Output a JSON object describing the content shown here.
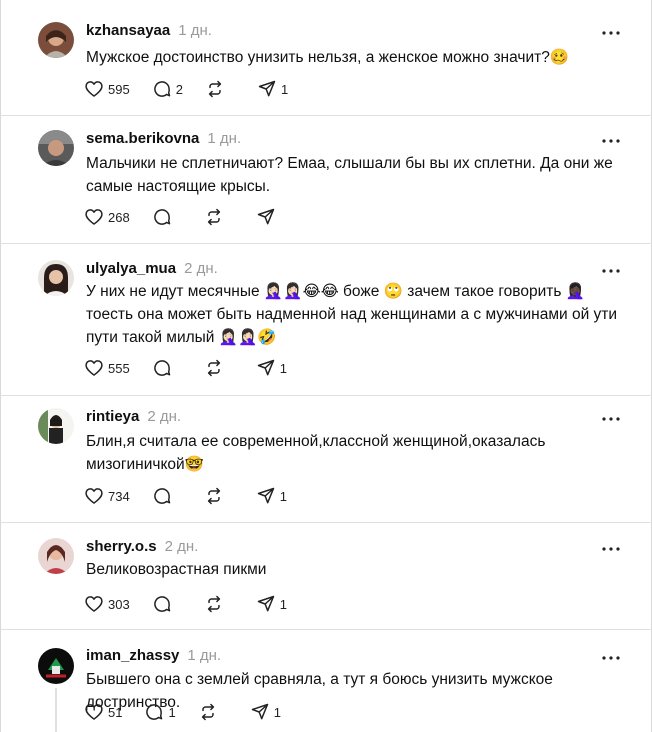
{
  "icons": {
    "like": "heart-icon",
    "reply": "comment-icon",
    "repost": "repost-icon",
    "share": "send-icon",
    "more": "more-dots-icon"
  },
  "colors": {
    "text": "#101010",
    "muted": "#9a9a9a",
    "divider": "#e0e0e0"
  },
  "posts": [
    {
      "username": "kzhansayaa",
      "time": "1 дн.",
      "text": "Мужское достоинство унизить нельзя, а женское можно значит?🥴",
      "likes": "595",
      "replies": "2",
      "reposts": "",
      "shares": "1"
    },
    {
      "username": "sema.berikovna",
      "time": "1 дн.",
      "text": "Мальчики не сплетничают? Емаа, слышали бы вы их сплетни. Да они же самые настоящие крысы.",
      "likes": "268",
      "replies": "",
      "reposts": "",
      "shares": ""
    },
    {
      "username": "ulyalya_mua",
      "time": "2 дн.",
      "text": "У них не идут месячные 🤦🏻‍♀️🤦🏻‍♀️😂😂 боже 🙄 зачем такое говорить 🤦🏿‍♀️ тоесть она может быть надменной над женщинами а с мужчинами ой ути пути такой милый 🤦🏻‍♀️🤦🏻‍♀️🤣",
      "likes": "555",
      "replies": "",
      "reposts": "",
      "shares": "1"
    },
    {
      "username": "rintieya",
      "time": "2 дн.",
      "text": "Блин,я считала ее современной,классной женщиной,оказалась мизогиничкой🤓",
      "likes": "734",
      "replies": "",
      "reposts": "",
      "shares": "1"
    },
    {
      "username": "sherry.o.s",
      "time": "2 дн.",
      "text": "Великовозрастная пикми",
      "likes": "303",
      "replies": "",
      "reposts": "",
      "shares": "1"
    },
    {
      "username": "iman_zhassy",
      "time": "1 дн.",
      "text": "Бывшего она с землей сравняла, а тут я боюсь унизить мужское достринство.",
      "likes": "51",
      "replies": "1",
      "reposts": "",
      "shares": "1"
    }
  ]
}
